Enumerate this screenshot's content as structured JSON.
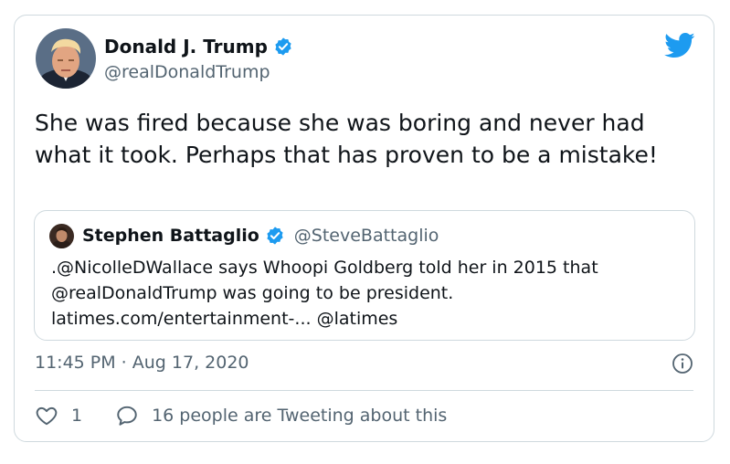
{
  "tweet": {
    "author_name": "Donald J. Trump",
    "author_handle": "@realDonaldTrump",
    "text": "She was fired because she was boring and never had what it took. Perhaps that has proven to be a mistake!",
    "timestamp": "11:45 PM · Aug 17, 2020",
    "like_count": "1",
    "discussion_text": "16 people are Tweeting about this"
  },
  "quoted": {
    "author_name": "Stephen Battaglio",
    "author_handle": "@SteveBattaglio",
    "text": ".@NicolleDWallace says Whoopi Goldberg told her in 2015 that @realDonaldTrump was going to be president. latimes.com/entertainment-... @latimes"
  },
  "colors": {
    "twitter_blue": "#1d9bf0",
    "secondary_text": "#536471",
    "border": "#cfd9de"
  },
  "icons": [
    "avatar",
    "verified-icon",
    "twitter-bird-icon",
    "info-icon",
    "heart-icon",
    "speech-bubble-icon"
  ]
}
